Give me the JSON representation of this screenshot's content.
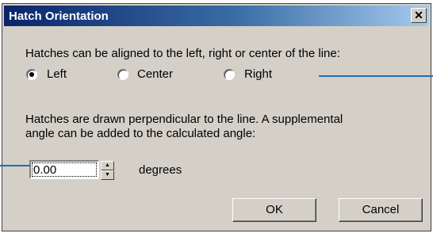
{
  "window": {
    "title": "Hatch Orientation",
    "close_glyph": "✕"
  },
  "alignment": {
    "text": "Hatches can be aligned to the left, right or center of the line:",
    "options": [
      {
        "label": "Left",
        "selected": true
      },
      {
        "label": "Center",
        "selected": false
      },
      {
        "label": "Right",
        "selected": false
      }
    ]
  },
  "angle": {
    "text_line1": "Hatches are drawn perpendicular to the line. A supplemental",
    "text_line2": "angle can be added to the calculated angle:",
    "value": "0.00",
    "unit": "degrees"
  },
  "buttons": {
    "ok": "OK",
    "cancel": "Cancel"
  },
  "colors": {
    "titlebar_start": "#0a246a",
    "titlebar_end": "#a6caf0",
    "callout": "#1f6fb0",
    "face": "#d4d0c8"
  }
}
